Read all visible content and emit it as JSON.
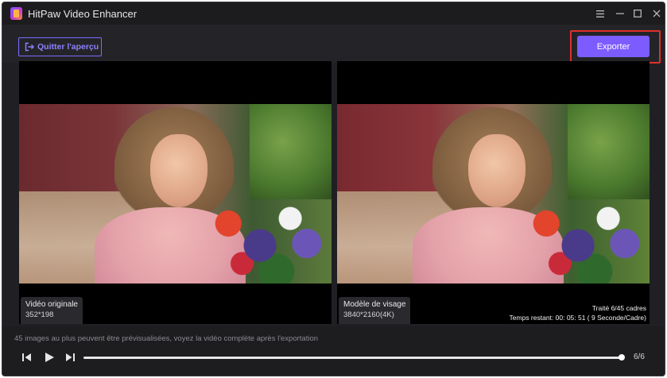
{
  "app": {
    "title": "HitPaw Video Enhancer"
  },
  "window_controls": {
    "menu_icon": "hamburger-icon",
    "minimize_icon": "minimize-icon",
    "maximize_icon": "maximize-icon",
    "close_icon": "close-icon"
  },
  "toolbar": {
    "quit_label": "Quitter l'aperçu",
    "export_label": "Exporter",
    "accent_color": "#7c5cff",
    "highlight_color": "#e0302c"
  },
  "left_pane": {
    "title": "Vidéo originale",
    "resolution": "352*198"
  },
  "right_pane": {
    "title": "Modèle de visage",
    "resolution": "3840*2160(4K)",
    "processed": "Traité 6/45 cadres",
    "remaining": "Temps restant: 00: 05: 51 ( 9 Seconde/Cadre)"
  },
  "player": {
    "notice": "45 images au plus peuvent être prévisualisées, voyez la vidéo complète après l'exportation",
    "frame_counter": "6/6",
    "progress": 1.0
  }
}
